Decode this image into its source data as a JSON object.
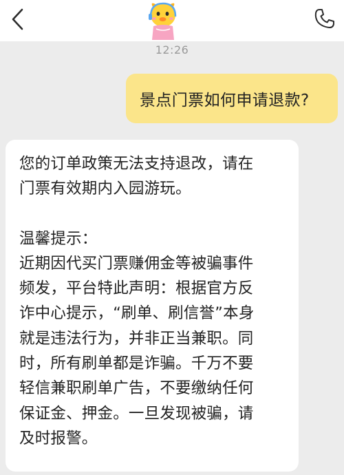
{
  "header": {
    "back_icon": "chevron-left-icon",
    "avatar_icon": "yellow-chick-mascot-avatar",
    "call_icon": "phone-icon"
  },
  "timestamp": "12:26",
  "messages": [
    {
      "sender": "user",
      "text": "景点门票如何申请退款?"
    },
    {
      "sender": "bot",
      "paragraphs": [
        "您的订单政策无法支持退改，请在\n门票有效期内入园游玩。",
        "温馨提示：\n近期因代买门票赚佣金等被骗事件\n频发，平台特此声明：根据官方反\n诈中心提示，“刷单、刷信誉”本身\n就是违法行为，并非正当兼职。同\n时，所有刷单都是诈骗。千万不要\n轻信兼职刷单广告，不要缴纳任何\n保证金、押金。一旦发现被骗，请\n及时报警。"
      ]
    }
  ],
  "colors": {
    "user_bubble": "#fbe58a",
    "bot_bubble": "#ffffff",
    "background": "#ececec"
  }
}
